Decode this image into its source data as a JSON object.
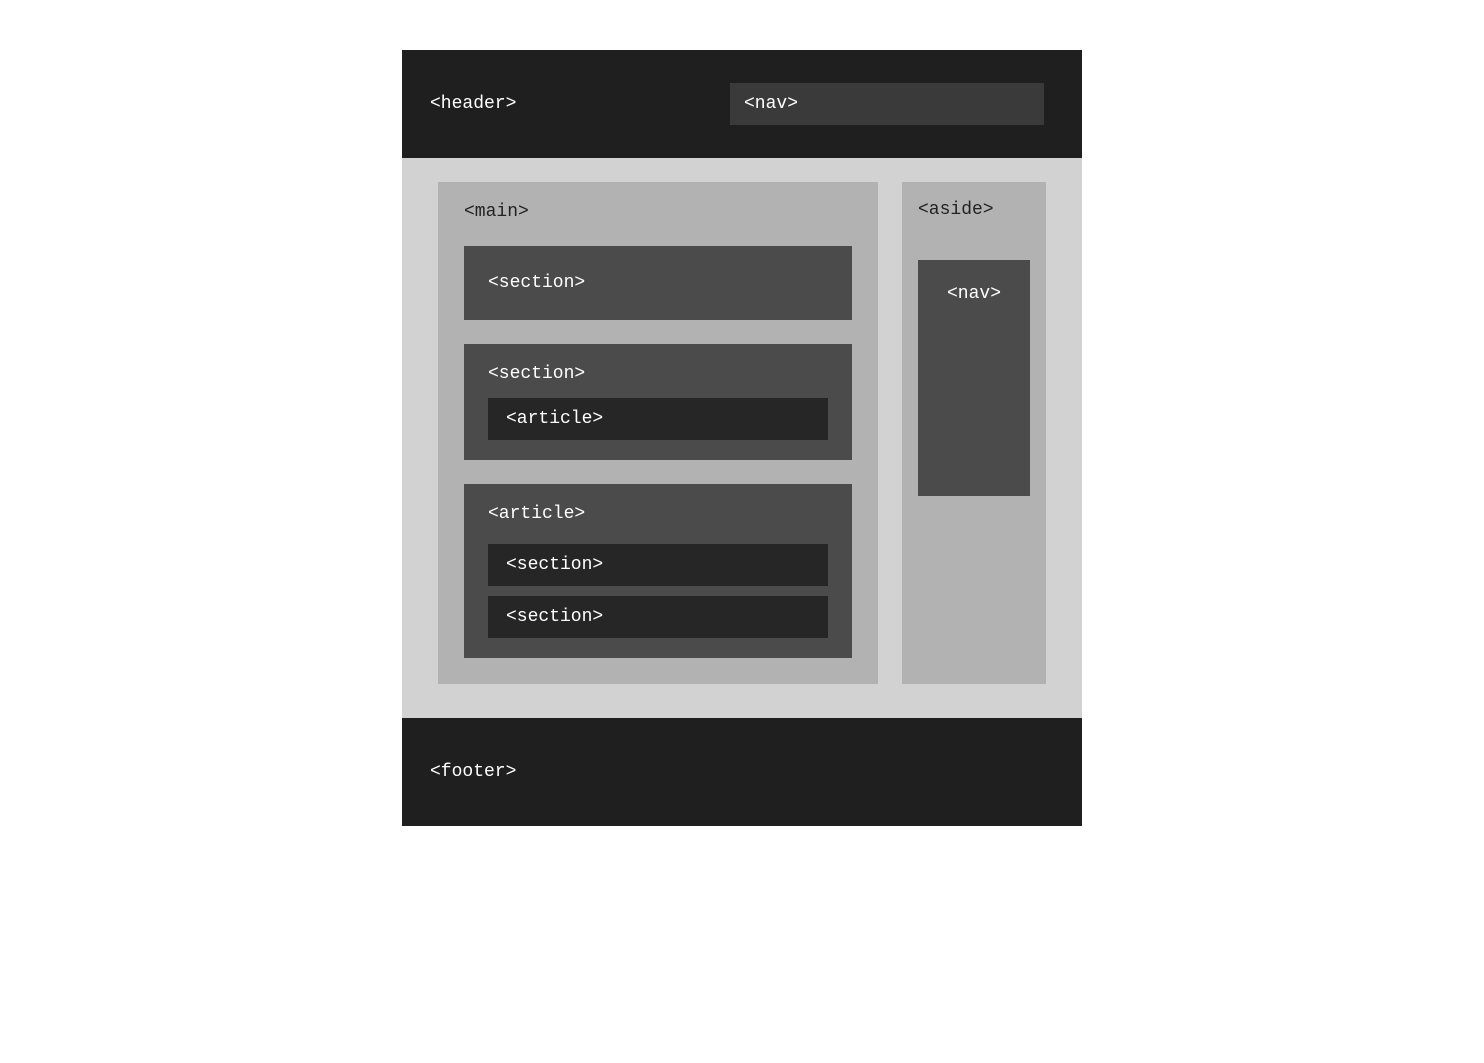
{
  "header": {
    "label": "<header>",
    "nav_label": "<nav>"
  },
  "main": {
    "label": "<main>",
    "blocks": [
      {
        "label": "<section>",
        "children": []
      },
      {
        "label": "<section>",
        "children": [
          {
            "label": "<article>"
          }
        ]
      },
      {
        "label": "<article>",
        "children": [
          {
            "label": "<section>"
          },
          {
            "label": "<section>"
          }
        ]
      }
    ]
  },
  "aside": {
    "label": "<aside>",
    "nav_label": "<nav>"
  },
  "footer": {
    "label": "<footer>"
  }
}
